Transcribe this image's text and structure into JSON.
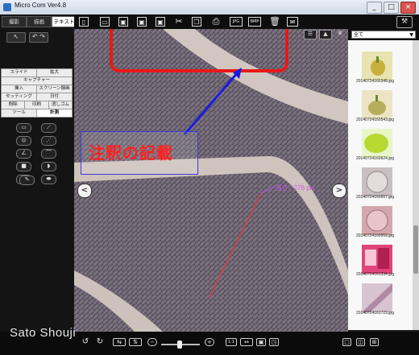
{
  "window": {
    "title": "Micro Com Ver4.8",
    "buttons": [
      "_",
      "□",
      "×"
    ]
  },
  "left_panel": {
    "tabs": [
      "撮影",
      "描画",
      "テキスト"
    ],
    "active_tab": "テキスト",
    "menu_rows": [
      [
        "スライド",
        "拡大"
      ],
      [
        "キャプチャー"
      ],
      [
        "挿入",
        "スクリーン録画"
      ],
      [
        "セッティング",
        "日付"
      ],
      [
        "削除",
        "印刷",
        "消しゴム"
      ],
      [
        "ツール",
        "計測"
      ]
    ],
    "selected_menu": "計測"
  },
  "toolbar_icons": [
    "new-file-icon",
    "open-folder-icon",
    "save-icon",
    "save-as-icon",
    "cut-icon",
    "copy-icon",
    "print-icon",
    "jpg-icon",
    "bmp-icon",
    "trash-icon",
    "mail-icon",
    "settings-icon"
  ],
  "toolbar_labels": {
    "jpg": "JPG",
    "bmp": "BMP"
  },
  "viewer": {
    "annotation_text": "注釈の記載",
    "measure_label": "長さ : 276 pix",
    "nav_left": "<",
    "nav_right": ">"
  },
  "right_panel": {
    "filter_value": "全て",
    "thumbnails": [
      {
        "label": "20140724160348.jpg",
        "color": "#d9c94a"
      },
      {
        "label": "20140724160543.jpg",
        "color": "#cfc07e"
      },
      {
        "label": "20140724160624.jpg",
        "color": "#b8d832"
      },
      {
        "label": "20140724160657.jpg",
        "color": "#c9bfc0"
      },
      {
        "label": "20140724160959.jpg",
        "color": "#d4a7ad"
      },
      {
        "label": "20140724161334.jpg",
        "color": "#e0447a"
      },
      {
        "label": "20140724161723.jpg",
        "color": "#cfb2c4"
      }
    ]
  },
  "bottom_bar": {
    "zoom_ratio": "1:1",
    "watermark": "Sato Shouji"
  }
}
